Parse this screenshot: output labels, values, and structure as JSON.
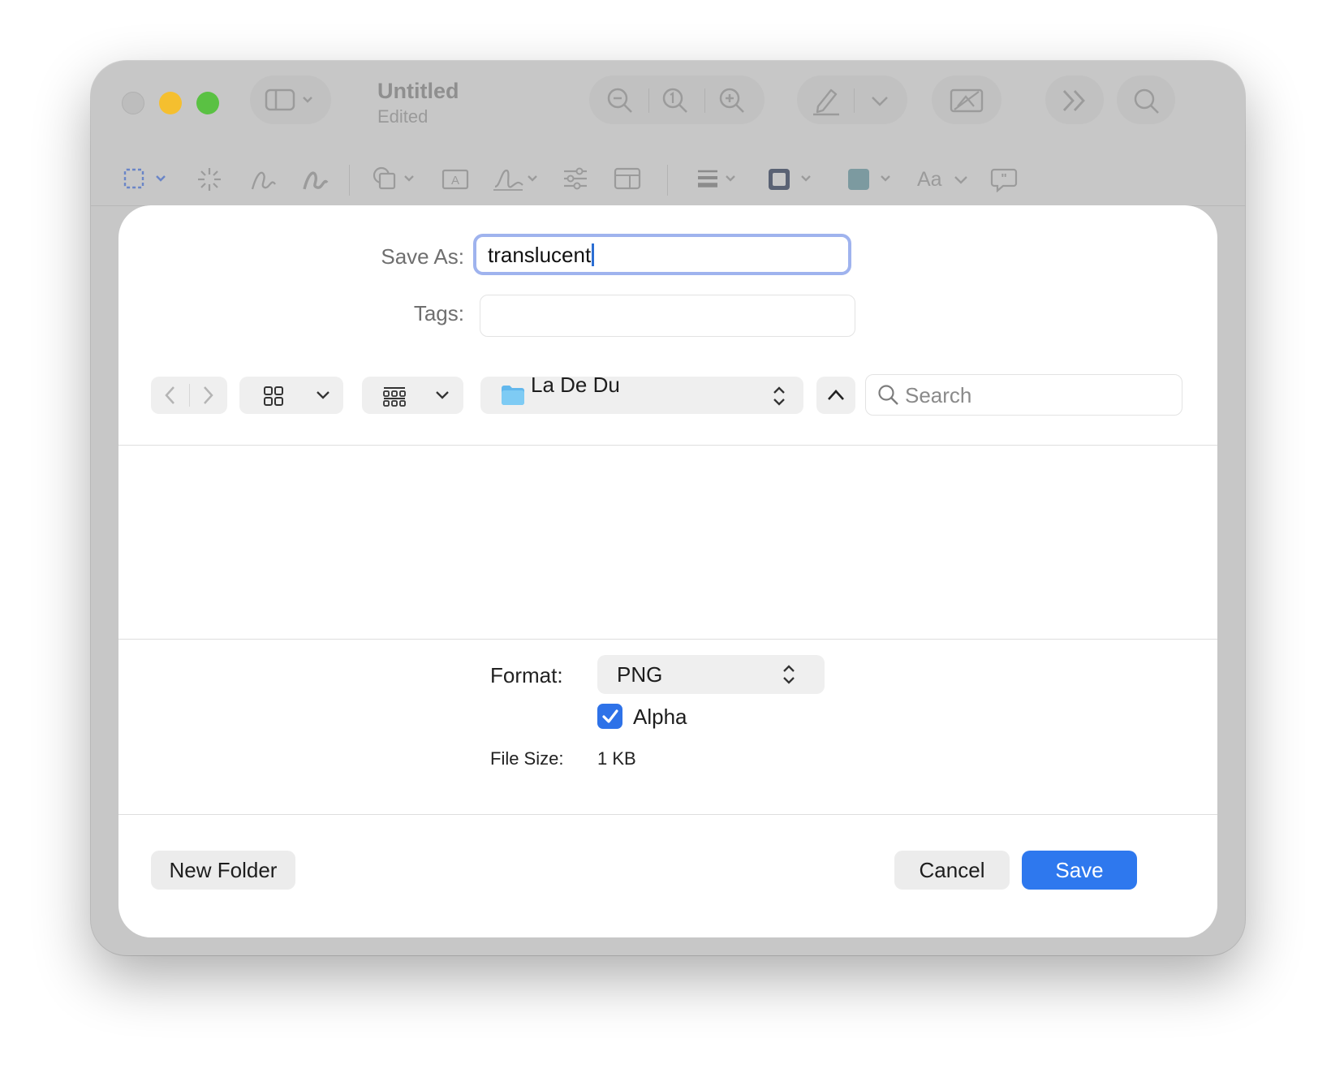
{
  "window": {
    "title": "Untitled",
    "subtitle": "Edited",
    "toolbar_icons": [
      "sidebar-icon",
      "zoom-out-icon",
      "actual-size-icon",
      "zoom-in-icon",
      "markup-pen-icon",
      "rotate-image-icon",
      "more-icon",
      "search-icon"
    ],
    "markup_icons": [
      "selection-icon",
      "instant-alpha-icon",
      "sketch-icon",
      "draw-icon",
      "shapes-icon",
      "text-box-icon",
      "signature-icon",
      "adjust-color-icon",
      "adjust-size-icon",
      "line-style-icon",
      "border-color-icon",
      "fill-color-icon",
      "text-style-icon",
      "annotate-icon"
    ],
    "text_style_label": "Aa"
  },
  "dialog": {
    "save_as_label": "Save As:",
    "save_as_value": "translucent",
    "tags_label": "Tags:",
    "tags_value": "",
    "location": "La De Du",
    "search_placeholder": "Search",
    "format_label": "Format:",
    "format_value": "PNG",
    "alpha_label": "Alpha",
    "alpha_checked": true,
    "file_size_label": "File Size:",
    "file_size_value": "1 KB",
    "new_folder_label": "New Folder",
    "cancel_label": "Cancel",
    "save_label": "Save",
    "accent_color": "#2e78ee"
  }
}
